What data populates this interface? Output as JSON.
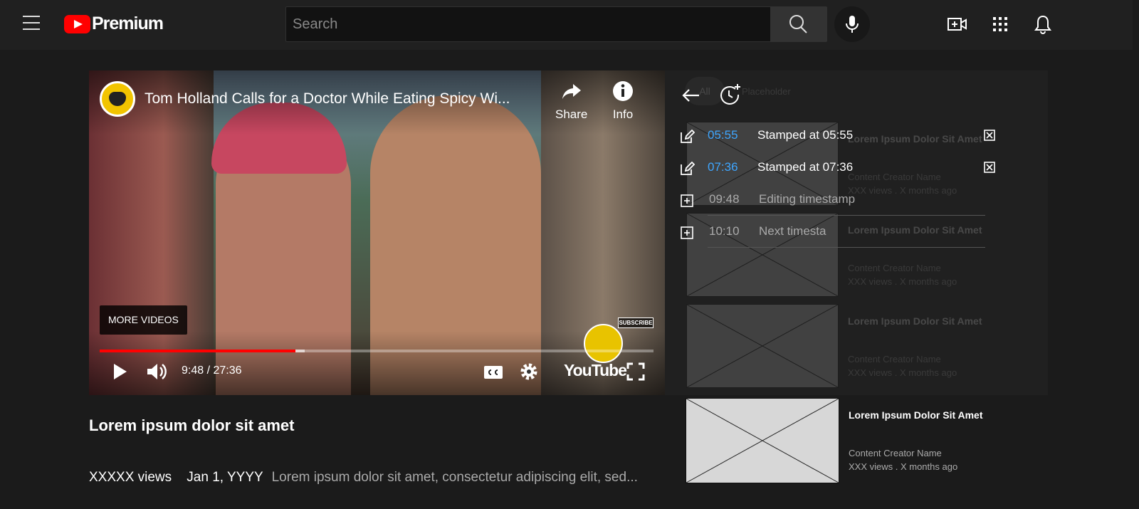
{
  "header": {
    "logo_text": "Premium",
    "search_placeholder": "Search",
    "icons": [
      "menu-icon",
      "search-icon",
      "mic-icon",
      "create-video-icon",
      "apps-icon",
      "notifications-icon"
    ],
    "brand_color": "#ff0000"
  },
  "player": {
    "title": "Tom Holland Calls for a Doctor While Eating Spicy Wi...",
    "share_label": "Share",
    "info_label": "Info",
    "more_videos_label": "MORE VIDEOS",
    "subscribe_label": "SUBSCRIBE",
    "time_display": "9:48 / 27:36",
    "wordmark": "YouTube",
    "progress": {
      "played_fraction": 0.353,
      "buffered_fraction": 0.37
    }
  },
  "video_info": {
    "title": "Lorem ipsum dolor sit amet",
    "views": "XXXXX views",
    "date": "Jan 1, YYYY",
    "description": "Lorem ipsum dolor sit amet, consectetur adipiscing elit, sed..."
  },
  "panel": {
    "ghost_chip": "All",
    "ghost_placeholder": "Placeholder",
    "timestamps": [
      {
        "time": "05:55",
        "label": "Stamped at 05:55",
        "state": "saved"
      },
      {
        "time": "07:36",
        "label": "Stamped at 07:36",
        "state": "saved"
      },
      {
        "time": "09:48",
        "label": "Editing timestamp",
        "state": "editing"
      },
      {
        "time": "10:10",
        "label": "Next timesta",
        "state": "editing"
      }
    ],
    "colors": {
      "saved_time": "#3ea6ff",
      "edit_time": "#aaaaaa"
    }
  },
  "recommendations": [
    {
      "title": "Lorem Ipsum Dolor Sit Amet",
      "creator": "Content Creator Name",
      "stats": "XXX views . X months ago"
    },
    {
      "title": "Lorem Ipsum Dolor Sit Amet",
      "creator": "Content Creator Name",
      "stats": "XXX views . X months ago"
    },
    {
      "title": "Lorem Ipsum Dolor Sit Amet",
      "creator": "Content Creator Name",
      "stats": "XXX views . X months ago"
    },
    {
      "title": "Lorem Ipsum Dolor Sit Amet",
      "creator": "Content Creator Name",
      "stats": "XXX views . X months ago"
    }
  ]
}
